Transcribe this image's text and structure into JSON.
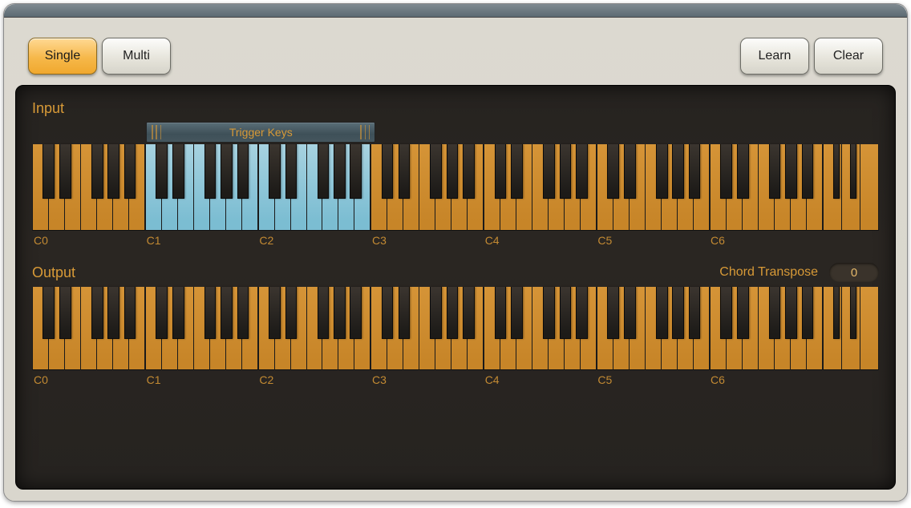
{
  "toolbar": {
    "mode_single": "Single",
    "mode_multi": "Multi",
    "learn": "Learn",
    "clear": "Clear",
    "active_mode": "Single"
  },
  "input": {
    "label": "Input",
    "trigger_label": "Trigger Keys",
    "trigger_range": {
      "start_note": "C1",
      "end_note": "B2"
    },
    "octave_labels": [
      "C0",
      "C1",
      "C2",
      "C3",
      "C4",
      "C5",
      "C6"
    ]
  },
  "output": {
    "label": "Output",
    "chord_transpose_label": "Chord Transpose",
    "chord_transpose_value": "0",
    "octave_labels": [
      "C0",
      "C1",
      "C2",
      "C3",
      "C4",
      "C5",
      "C6"
    ]
  },
  "colors": {
    "accent": "#d89a37",
    "white_key": "#c78528",
    "selected_key": "#7bbdd2",
    "black_key": "#1d1b18",
    "panel_bg": "#262320"
  }
}
